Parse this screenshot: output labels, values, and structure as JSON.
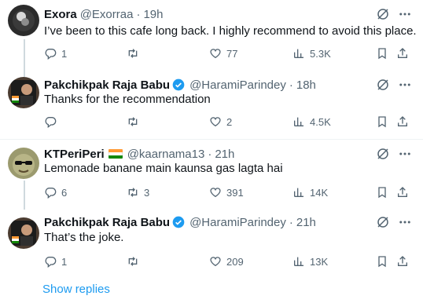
{
  "tweets": [
    {
      "name": "Exora",
      "handle": "@Exorraa",
      "time": "19h",
      "verified": false,
      "flag": false,
      "avatar": "exora-avatar",
      "text": "I’ve been to this cafe long back. I highly recommend to avoid this place.",
      "replies": "1",
      "retweets": "",
      "likes": "77",
      "views": "5.3K"
    },
    {
      "name": "Pakchikpak Raja Babu",
      "handle": "@HaramiParindey",
      "time": "18h",
      "verified": true,
      "flag": false,
      "avatar": "raja-babu-avatar",
      "text": "Thanks for the recommendation",
      "replies": "",
      "retweets": "",
      "likes": "2",
      "views": "4.5K"
    },
    {
      "name": "KTPeriPeri",
      "handle": "@kaarnama13",
      "time": "21h",
      "verified": false,
      "flag": true,
      "avatar": "ktperiperi-avatar",
      "text": "Lemonade banane main kaunsa gas lagta hai",
      "replies": "6",
      "retweets": "3",
      "likes": "391",
      "views": "14K"
    },
    {
      "name": "Pakchikpak Raja Babu",
      "handle": "@HaramiParindey",
      "time": "21h",
      "verified": true,
      "flag": false,
      "avatar": "raja-babu-avatar",
      "text": "That’s the joke.",
      "replies": "1",
      "retweets": "",
      "likes": "209",
      "views": "13K"
    }
  ],
  "show_replies_label": "Show replies",
  "colors": {
    "text": "#0f1419",
    "secondary": "#536471",
    "link": "#1d9bf0",
    "verified": "#1d9bf0",
    "divider": "#eff3f4",
    "thread_line": "#cfd9de"
  },
  "icons": [
    "reply-icon",
    "retweet-icon",
    "like-icon",
    "views-icon",
    "bookmark-icon",
    "share-icon",
    "grok-icon",
    "more-icon",
    "verified-icon",
    "india-flag-icon"
  ]
}
